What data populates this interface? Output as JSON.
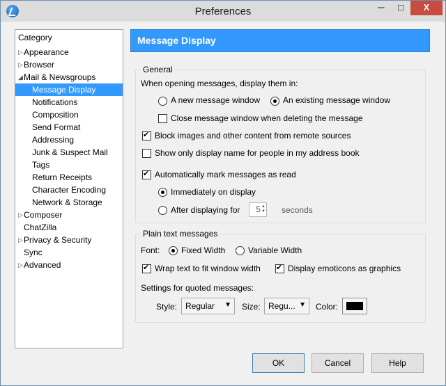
{
  "window": {
    "title": "Preferences",
    "min": "─",
    "max": "□",
    "close": "X"
  },
  "sidebar": {
    "header": "Category",
    "items": [
      {
        "label": "Appearance"
      },
      {
        "label": "Browser"
      },
      {
        "label": "Mail & Newsgroups"
      },
      {
        "label": "Message Display"
      },
      {
        "label": "Notifications"
      },
      {
        "label": "Composition"
      },
      {
        "label": "Send Format"
      },
      {
        "label": "Addressing"
      },
      {
        "label": "Junk & Suspect Mail"
      },
      {
        "label": "Tags"
      },
      {
        "label": "Return Receipts"
      },
      {
        "label": "Character Encoding"
      },
      {
        "label": "Network & Storage"
      },
      {
        "label": "Composer"
      },
      {
        "label": "ChatZilla"
      },
      {
        "label": "Privacy & Security"
      },
      {
        "label": "Sync"
      },
      {
        "label": "Advanced"
      }
    ]
  },
  "panel": {
    "title": "Message Display"
  },
  "general": {
    "legend": "General",
    "open_label": "When opening messages, display them in:",
    "new_window": "A new message window",
    "existing_window": "An existing message window",
    "close_on_delete": "Close message window when deleting the message",
    "block_images": "Block images and other content from remote sources",
    "show_display_name": "Show only display name for people in my address book",
    "auto_mark": "Automatically mark messages as read",
    "immediately": "Immediately on display",
    "after_displaying": "After displaying for",
    "seconds_value": "5",
    "seconds_label": "seconds"
  },
  "plain": {
    "legend": "Plain text messages",
    "font_label": "Font:",
    "fixed": "Fixed Width",
    "variable": "Variable Width",
    "wrap": "Wrap text to fit window width",
    "emoticons": "Display emoticons as graphics",
    "quoted_label": "Settings for quoted messages:",
    "style_label": "Style:",
    "style_value": "Regular",
    "size_label": "Size:",
    "size_value": "Regu...",
    "color_label": "Color:",
    "color_value": "#000000"
  },
  "buttons": {
    "ok": "OK",
    "cancel": "Cancel",
    "help": "Help"
  }
}
